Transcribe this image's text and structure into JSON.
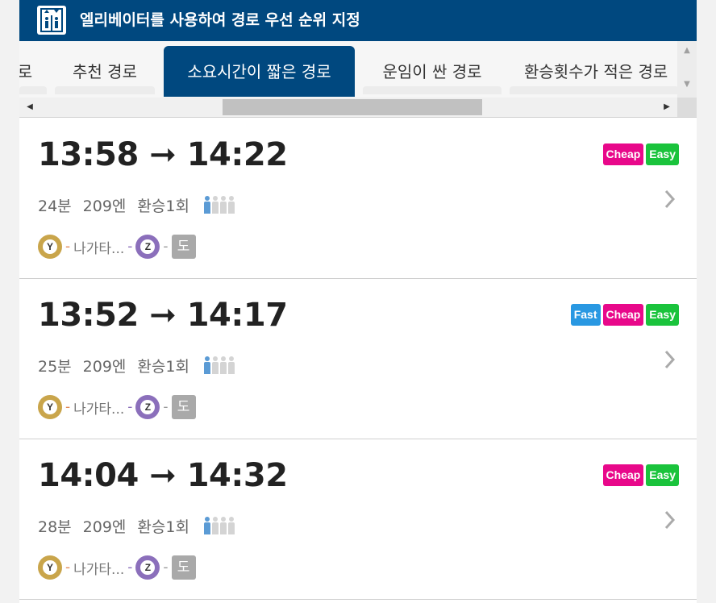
{
  "header": {
    "title": "엘리베이터를 사용하여 경로 우선 순위 지정",
    "icon": "elevator-icon"
  },
  "tabs": [
    {
      "label": "로",
      "active": false
    },
    {
      "label": "추천 경로",
      "active": false
    },
    {
      "label": "소요시간이 짧은 경로",
      "active": true
    },
    {
      "label": "운임이 싼 경로",
      "active": false
    },
    {
      "label": "환승횟수가 적은 경로",
      "active": false
    }
  ],
  "colors": {
    "header": "#00487f",
    "cheap": "#e8088a",
    "easy": "#1ac33c",
    "fast": "#2998e2",
    "yline": "#c9a54b",
    "zline": "#8b6fbb",
    "crowd_on": "#5b9bd5",
    "crowd_off": "#d4d4d4"
  },
  "routes": [
    {
      "depart": "13:58",
      "arrow": "➞",
      "arrive": "14:22",
      "tags": [
        {
          "label": "Cheap",
          "color": "#e8088a"
        },
        {
          "label": "Easy",
          "color": "#1ac33c"
        }
      ],
      "duration": "24분",
      "fare": "209엔",
      "transfers": "환승1회",
      "crowd_level": 1,
      "segments": {
        "line1": "Y",
        "station1": "나가타...",
        "line2": "Z",
        "station2": "도"
      }
    },
    {
      "depart": "13:52",
      "arrow": "➞",
      "arrive": "14:17",
      "tags": [
        {
          "label": "Fast",
          "color": "#2998e2"
        },
        {
          "label": "Cheap",
          "color": "#e8088a"
        },
        {
          "label": "Easy",
          "color": "#1ac33c"
        }
      ],
      "duration": "25분",
      "fare": "209엔",
      "transfers": "환승1회",
      "crowd_level": 1,
      "segments": {
        "line1": "Y",
        "station1": "나가타...",
        "line2": "Z",
        "station2": "도"
      }
    },
    {
      "depart": "14:04",
      "arrow": "➞",
      "arrive": "14:32",
      "tags": [
        {
          "label": "Cheap",
          "color": "#e8088a"
        },
        {
          "label": "Easy",
          "color": "#1ac33c"
        }
      ],
      "duration": "28분",
      "fare": "209엔",
      "transfers": "환승1회",
      "crowd_level": 1,
      "segments": {
        "line1": "Y",
        "station1": "나가타...",
        "line2": "Z",
        "station2": "도"
      }
    }
  ]
}
